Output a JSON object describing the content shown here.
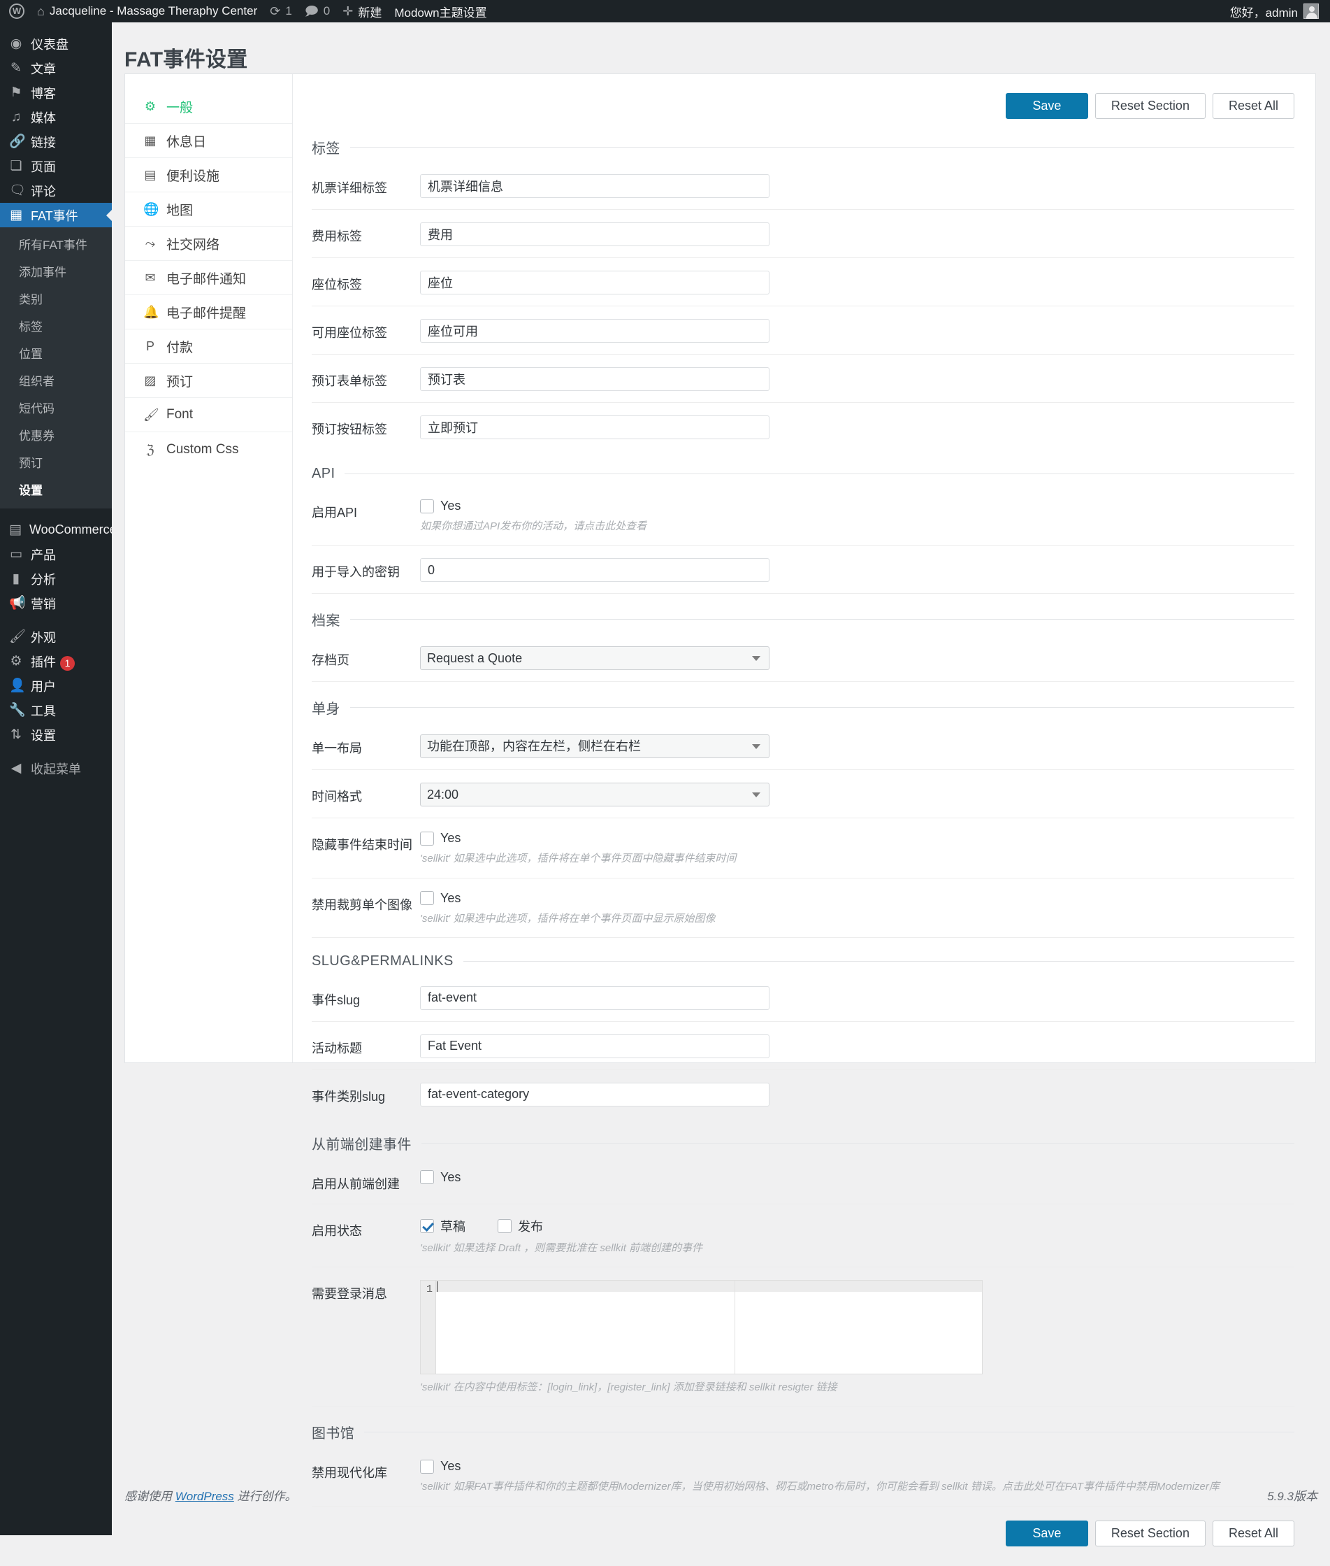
{
  "adminbar": {
    "logo_icon": "wordpress-logo-icon",
    "home_icon": "home-icon",
    "site_name": "Jacqueline - Massage Theraphy Center",
    "updates_icon": "updates-icon",
    "updates_count": "1",
    "comments_icon": "comment-icon",
    "comments_count": "0",
    "new_icon": "plus-icon",
    "new_label": "新建",
    "theme_settings_label": "Modown主题设置",
    "greeting": "您好，admin"
  },
  "adminmenu": {
    "items": [
      {
        "icon": "dashboard-icon",
        "glyph": "◉",
        "label": "仪表盘",
        "current": false
      },
      {
        "icon": "posts-icon",
        "glyph": "✎",
        "label": "文章",
        "current": false
      },
      {
        "icon": "blog-icon",
        "glyph": "⚑",
        "label": "博客",
        "current": false
      },
      {
        "icon": "media-icon",
        "glyph": "♫",
        "label": "媒体",
        "current": false
      },
      {
        "icon": "link-icon",
        "glyph": "🔗",
        "label": "链接",
        "current": false
      },
      {
        "icon": "pages-icon",
        "glyph": "❏",
        "label": "页面",
        "current": false
      },
      {
        "icon": "comments-icon",
        "glyph": "🗨",
        "label": "评论",
        "current": false
      },
      {
        "icon": "calendar-icon",
        "glyph": "▦",
        "label": "FAT事件",
        "current": true
      }
    ],
    "submenu": [
      {
        "label": "所有FAT事件",
        "current": false
      },
      {
        "label": "添加事件",
        "current": false
      },
      {
        "label": "类别",
        "current": false
      },
      {
        "label": "标签",
        "current": false
      },
      {
        "label": "位置",
        "current": false
      },
      {
        "label": "组织者",
        "current": false
      },
      {
        "label": "短代码",
        "current": false
      },
      {
        "label": "优惠券",
        "current": false
      },
      {
        "label": "预订",
        "current": false
      },
      {
        "label": "设置",
        "current": true
      }
    ],
    "items2": [
      {
        "icon": "woocommerce-icon",
        "glyph": "▤",
        "label": "WooCommerce",
        "badge": ""
      },
      {
        "icon": "products-icon",
        "glyph": "▭",
        "label": "产品",
        "badge": ""
      },
      {
        "icon": "analytics-icon",
        "glyph": "▮",
        "label": "分析",
        "badge": ""
      },
      {
        "icon": "marketing-icon",
        "glyph": "📢",
        "label": "营销",
        "badge": ""
      }
    ],
    "items3": [
      {
        "icon": "appearance-icon",
        "glyph": "🖌",
        "label": "外观",
        "badge": ""
      },
      {
        "icon": "plugins-icon",
        "glyph": "⚙",
        "label": "插件",
        "badge": "1"
      },
      {
        "icon": "users-icon",
        "glyph": "👤",
        "label": "用户",
        "badge": ""
      },
      {
        "icon": "tools-icon",
        "glyph": "🔧",
        "label": "工具",
        "badge": ""
      },
      {
        "icon": "settings-icon",
        "glyph": "⇅",
        "label": "设置",
        "badge": ""
      }
    ],
    "collapse": {
      "icon": "collapse-icon",
      "glyph": "◀",
      "label": "收起菜单"
    }
  },
  "page": {
    "title": "FAT事件设置"
  },
  "tabs": [
    {
      "icon": "gears-icon",
      "glyph": "⚙",
      "label": "一般",
      "active": true
    },
    {
      "icon": "calendar-icon",
      "glyph": "▦",
      "label": "休息日",
      "active": false
    },
    {
      "icon": "amenities-icon",
      "glyph": "▤",
      "label": "便利设施",
      "active": false
    },
    {
      "icon": "globe-icon",
      "glyph": "🌐",
      "label": "地图",
      "active": false
    },
    {
      "icon": "share-icon",
      "glyph": "⤳",
      "label": "社交网络",
      "active": false
    },
    {
      "icon": "envelope-icon",
      "glyph": "✉",
      "label": "电子邮件通知",
      "active": false
    },
    {
      "icon": "bell-icon",
      "glyph": "🔔",
      "label": "电子邮件提醒",
      "active": false
    },
    {
      "icon": "paypal-icon",
      "glyph": "P",
      "label": "付款",
      "active": false
    },
    {
      "icon": "calendar-check-icon",
      "glyph": "▨",
      "label": "预订",
      "active": false
    },
    {
      "icon": "brush-icon",
      "glyph": "🖌",
      "label": "Font",
      "active": false
    },
    {
      "icon": "css-icon",
      "glyph": "ℨ",
      "label": "Custom Css",
      "active": false
    }
  ],
  "toolbar": {
    "save_label": "Save",
    "reset_section_label": "Reset Section",
    "reset_all_label": "Reset All"
  },
  "sections": {
    "labels": {
      "title": "标签",
      "fields": [
        {
          "label": "机票详细标签",
          "value": "机票详细信息"
        },
        {
          "label": "费用标签",
          "value": "费用"
        },
        {
          "label": "座位标签",
          "value": "座位"
        },
        {
          "label": "可用座位标签",
          "value": "座位可用"
        },
        {
          "label": "预订表单标签",
          "value": "预订表"
        },
        {
          "label": "预订按钮标签",
          "value": "立即预订"
        }
      ]
    },
    "api": {
      "title": "API",
      "enable_label": "启用API",
      "enable_checkbox_label": "Yes",
      "enable_checked": false,
      "enable_hint": "如果你想通过API发布你的活动，请点击此处查看",
      "key_label": "用于导入的密钥",
      "key_value": "0"
    },
    "archive": {
      "title": "档案",
      "page_label": "存档页",
      "page_value": "Request a Quote"
    },
    "single": {
      "title": "单身",
      "layout_label": "单一布局",
      "layout_value": "功能在顶部，内容在左栏，侧栏在右栏",
      "time_format_label": "时间格式",
      "time_format_value": "24:00",
      "hide_end_label": "隐藏事件结束时间",
      "hide_end_checkbox_label": "Yes",
      "hide_end_checked": false,
      "hide_end_hint": "'sellkit' 如果选中此选项，插件将在单个事件页面中隐藏事件结束时间",
      "disable_crop_label": "禁用裁剪单个图像",
      "disable_crop_checkbox_label": "Yes",
      "disable_crop_checked": false,
      "disable_crop_hint": "'sellkit' 如果选中此选项，插件将在单个事件页面中显示原始图像"
    },
    "slug": {
      "title": "SLUG&PERMALINKS",
      "fields": [
        {
          "label": "事件slug",
          "value": "fat-event"
        },
        {
          "label": "活动标题",
          "value": "Fat Event"
        },
        {
          "label": "事件类别slug",
          "value": "fat-event-category"
        }
      ]
    },
    "frontend": {
      "title": "从前端创建事件",
      "enable_label": "启用从前端创建",
      "enable_checkbox_label": "Yes",
      "enable_checked": false,
      "status_label": "启用状态",
      "status_options": [
        {
          "label": "草稿",
          "checked": true
        },
        {
          "label": "发布",
          "checked": false
        }
      ],
      "status_hint": "'sellkit' 如果选择 Draft ，则需要批准在 sellkit 前端创建的事件",
      "login_msg_label": "需要登录消息",
      "login_msg_value": "",
      "login_msg_linenum": "1",
      "login_msg_hint": "'sellkit' 在内容中使用标签：[login_link]，[register_link] 添加登录链接和 sellkit resigter 链接"
    },
    "library": {
      "title": "图书馆",
      "disable_modernizr_label": "禁用现代化库",
      "disable_modernizr_checkbox_label": "Yes",
      "disable_modernizr_checked": false,
      "disable_modernizr_hint": "'sellkit' 如果FAT事件插件和你的主题都使用Modernizer库，当使用初始网格、砌石或metro布局时，你可能会看到 sellkit 错误。点击此处可在FAT事件插件中禁用Modernizer库"
    }
  },
  "footer": {
    "thanks_prefix": "感谢使用 ",
    "wordpress_link": "WordPress",
    "thanks_suffix": " 进行创作。",
    "version": "5.9.3版本"
  },
  "colors": {
    "admin_bg": "#1d2327",
    "menu_current": "#2271b1",
    "accent_green": "#2bc47d",
    "primary_button": "#0b78ab",
    "badge_red": "#d63638"
  }
}
